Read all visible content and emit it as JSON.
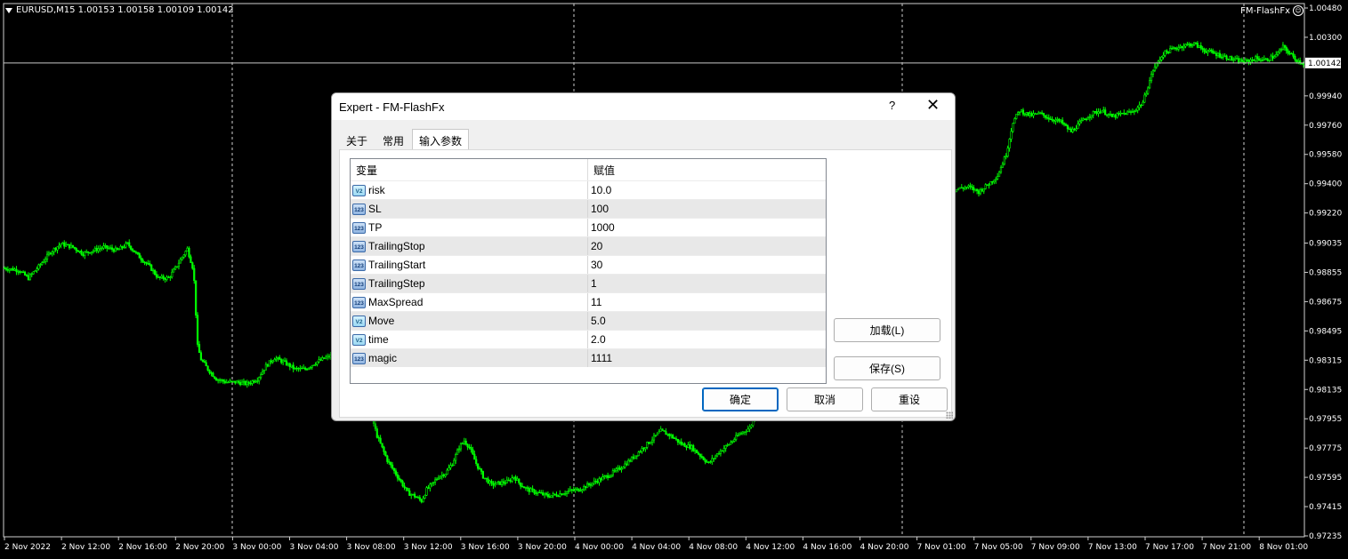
{
  "chart": {
    "symbol_line": "EURUSD,M15  1.00153 1.00158 1.00109 1.00142",
    "ea_name": "FM-FlashFx",
    "current_price_label": "1.00142",
    "current_price": 1.00142,
    "price_ticks": [
      "1.00480",
      "1.00300",
      "0.99940",
      "0.99760",
      "0.99580",
      "0.99400",
      "0.99220",
      "0.99035",
      "0.98855",
      "0.98675",
      "0.98495",
      "0.98315",
      "0.98135",
      "0.97955",
      "0.97775",
      "0.97595",
      "0.97415",
      "0.97235"
    ],
    "time_ticks": [
      "2 Nov 2022",
      "2 Nov 12:00",
      "2 Nov 16:00",
      "2 Nov 20:00",
      "3 Nov 00:00",
      "3 Nov 04:00",
      "3 Nov 08:00",
      "3 Nov 12:00",
      "3 Nov 16:00",
      "3 Nov 20:00",
      "4 Nov 00:00",
      "4 Nov 04:00",
      "4 Nov 08:00",
      "4 Nov 12:00",
      "4 Nov 16:00",
      "4 Nov 20:00",
      "7 Nov 01:00",
      "7 Nov 05:00",
      "7 Nov 09:00",
      "7 Nov 13:00",
      "7 Nov 17:00",
      "7 Nov 21:00",
      "8 Nov 01:00"
    ],
    "candle_color": "#00ff00",
    "background": "#000000",
    "price_path": [
      [
        0,
        0.9888
      ],
      [
        8,
        0.9887
      ],
      [
        14,
        0.9882
      ],
      [
        20,
        0.9889
      ],
      [
        27,
        0.9898
      ],
      [
        33,
        0.9903
      ],
      [
        40,
        0.9901
      ],
      [
        46,
        0.9897
      ],
      [
        52,
        0.9899
      ],
      [
        58,
        0.9901
      ],
      [
        66,
        0.9899
      ],
      [
        72,
        0.9903
      ],
      [
        78,
        0.9896
      ],
      [
        85,
        0.9889
      ],
      [
        90,
        0.9882
      ],
      [
        96,
        0.9882
      ],
      [
        100,
        0.9888
      ],
      [
        104,
        0.9895
      ],
      [
        107,
        0.99
      ],
      [
        110,
        0.9889
      ],
      [
        111,
        0.988
      ],
      [
        113,
        0.984
      ],
      [
        115,
        0.9832
      ],
      [
        119,
        0.9826
      ],
      [
        124,
        0.982
      ],
      [
        130,
        0.9818
      ],
      [
        136,
        0.9818
      ],
      [
        142,
        0.9817
      ],
      [
        148,
        0.982
      ],
      [
        153,
        0.9828
      ],
      [
        158,
        0.9833
      ],
      [
        164,
        0.983
      ],
      [
        170,
        0.9826
      ],
      [
        176,
        0.9826
      ],
      [
        182,
        0.983
      ],
      [
        188,
        0.9833
      ],
      [
        194,
        0.9835
      ],
      [
        200,
        0.983
      ],
      [
        206,
        0.9828
      ],
      [
        212,
        0.9818
      ],
      [
        214,
        0.98
      ],
      [
        218,
        0.9785
      ],
      [
        224,
        0.977
      ],
      [
        230,
        0.976
      ],
      [
        236,
        0.975
      ],
      [
        240,
        0.9748
      ],
      [
        244,
        0.9745
      ],
      [
        247,
        0.9752
      ],
      [
        250,
        0.9755
      ],
      [
        254,
        0.976
      ],
      [
        258,
        0.9762
      ],
      [
        262,
        0.9768
      ],
      [
        266,
        0.9778
      ],
      [
        269,
        0.9782
      ],
      [
        272,
        0.9778
      ],
      [
        276,
        0.9768
      ],
      [
        280,
        0.976
      ],
      [
        285,
        0.9755
      ],
      [
        290,
        0.9756
      ],
      [
        295,
        0.9757
      ],
      [
        298,
        0.976
      ],
      [
        302,
        0.9755
      ],
      [
        306,
        0.9752
      ],
      [
        312,
        0.975
      ],
      [
        318,
        0.9748
      ],
      [
        324,
        0.9749
      ],
      [
        330,
        0.9751
      ],
      [
        336,
        0.9752
      ],
      [
        342,
        0.9755
      ],
      [
        348,
        0.9758
      ],
      [
        354,
        0.9761
      ],
      [
        360,
        0.9765
      ],
      [
        366,
        0.977
      ],
      [
        372,
        0.9776
      ],
      [
        378,
        0.9782
      ],
      [
        384,
        0.9788
      ],
      [
        390,
        0.9785
      ],
      [
        396,
        0.978
      ],
      [
        402,
        0.9778
      ],
      [
        408,
        0.9772
      ],
      [
        412,
        0.9768
      ],
      [
        418,
        0.9775
      ],
      [
        424,
        0.978
      ],
      [
        430,
        0.9786
      ],
      [
        436,
        0.979
      ],
      [
        440,
        0.9798
      ],
      [
        444,
        0.9806
      ],
      [
        448,
        0.9812
      ],
      [
        452,
        0.982
      ],
      [
        458,
        0.983
      ],
      [
        464,
        0.984
      ],
      [
        470,
        0.985
      ],
      [
        476,
        0.9862
      ],
      [
        482,
        0.9875
      ],
      [
        488,
        0.9888
      ],
      [
        494,
        0.99
      ],
      [
        500,
        0.9912
      ],
      [
        508,
        0.9922
      ],
      [
        516,
        0.9928
      ],
      [
        524,
        0.9932
      ],
      [
        532,
        0.9935
      ],
      [
        540,
        0.9933
      ],
      [
        546,
        0.9932
      ],
      [
        552,
        0.9934
      ],
      [
        558,
        0.9937
      ],
      [
        564,
        0.9938
      ],
      [
        570,
        0.9935
      ],
      [
        576,
        0.994
      ],
      [
        581,
        0.9945
      ],
      [
        586,
        0.9958
      ],
      [
        590,
        0.9978
      ],
      [
        594,
        0.9985
      ],
      [
        600,
        0.9982
      ],
      [
        606,
        0.9983
      ],
      [
        612,
        0.998
      ],
      [
        618,
        0.9978
      ],
      [
        624,
        0.9972
      ],
      [
        630,
        0.9978
      ],
      [
        636,
        0.9983
      ],
      [
        642,
        0.9985
      ],
      [
        648,
        0.9981
      ],
      [
        654,
        0.9983
      ],
      [
        660,
        0.9984
      ],
      [
        666,
        0.999
      ],
      [
        672,
        1.001
      ],
      [
        678,
        1.002
      ],
      [
        684,
        1.0023
      ],
      [
        690,
        1.0025
      ],
      [
        696,
        1.0026
      ],
      [
        702,
        1.0022
      ],
      [
        708,
        1.002
      ],
      [
        714,
        1.0018
      ],
      [
        720,
        1.0016
      ],
      [
        726,
        1.0015
      ],
      [
        732,
        1.0017
      ],
      [
        738,
        1.0016
      ],
      [
        744,
        1.0019
      ],
      [
        748,
        1.0024
      ],
      [
        752,
        1.002
      ],
      [
        756,
        1.0016
      ],
      [
        760,
        1.0014
      ]
    ]
  },
  "dialog": {
    "title": "Expert - FM-FlashFx",
    "help": "?",
    "close": "✕",
    "tabs": [
      "关于",
      "常用",
      "输入参数"
    ],
    "grid": {
      "col_variable": "变量",
      "col_value": "赋值",
      "rows": [
        {
          "type": "double",
          "icon": "V2",
          "name": "risk",
          "value": "10.0"
        },
        {
          "type": "int",
          "icon": "123",
          "name": "SL",
          "value": "100"
        },
        {
          "type": "int",
          "icon": "123",
          "name": "TP",
          "value": "1000"
        },
        {
          "type": "int",
          "icon": "123",
          "name": "TrailingStop",
          "value": "20"
        },
        {
          "type": "int",
          "icon": "123",
          "name": "TrailingStart",
          "value": "30"
        },
        {
          "type": "int",
          "icon": "123",
          "name": "TrailingStep",
          "value": "1"
        },
        {
          "type": "int",
          "icon": "123",
          "name": "MaxSpread",
          "value": "11"
        },
        {
          "type": "double",
          "icon": "V2",
          "name": "Move",
          "value": "5.0"
        },
        {
          "type": "double",
          "icon": "V2",
          "name": "time",
          "value": "2.0"
        },
        {
          "type": "int",
          "icon": "123",
          "name": "magic",
          "value": "1111"
        }
      ]
    },
    "buttons": {
      "load": "加载(L)",
      "save": "保存(S)",
      "ok": "确定",
      "cancel": "取消",
      "reset": "重设"
    }
  }
}
